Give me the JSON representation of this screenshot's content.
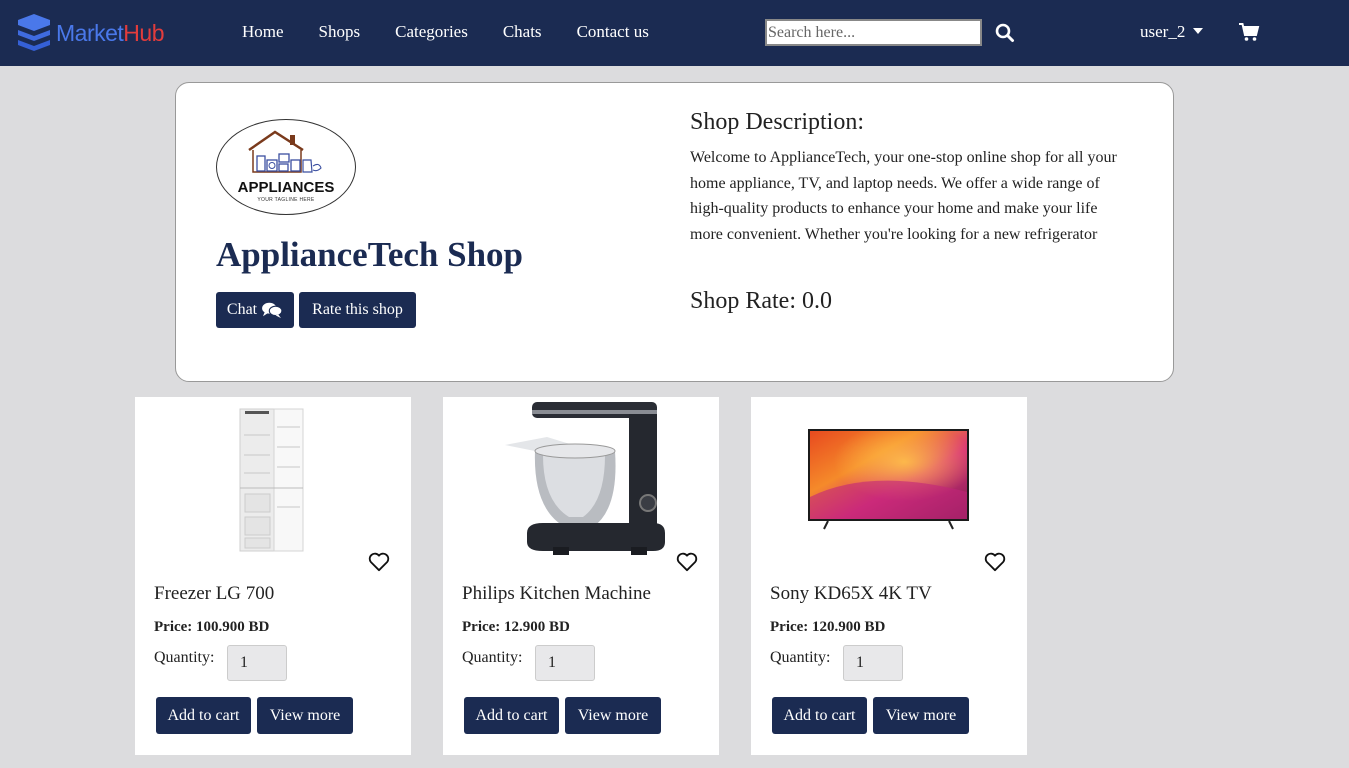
{
  "brand": {
    "part1": "Market",
    "part2": "Hub"
  },
  "nav": {
    "items": [
      "Home",
      "Shops",
      "Categories",
      "Chats",
      "Contact us"
    ]
  },
  "search": {
    "placeholder": "Search here...",
    "value": ""
  },
  "user": {
    "name": "user_2"
  },
  "shop": {
    "logo_text": "APPLIANCES",
    "logo_tagline": "YOUR TAGLINE HERE",
    "name": "ApplianceTech Shop",
    "chat_label": "Chat",
    "rate_label": "Rate this shop",
    "description_title": "Shop Description:",
    "description": "Welcome to ApplianceTech, your one-stop online shop for all your home appliance, TV, and laptop needs. We offer a wide range of high-quality products to enhance your home and make your life more convenient. Whether you're looking for a new refrigerator",
    "rate_label_text": "Shop Rate:",
    "rate_value": "0.0"
  },
  "products": [
    {
      "name": "Freezer LG 700",
      "price": "Price: 100.900 BD",
      "quantity_label": "Quantity:",
      "quantity": "1",
      "add_label": "Add to cart",
      "view_label": "View more",
      "image": "fridge"
    },
    {
      "name": "Philips Kitchen Machine",
      "price": "Price: 12.900 BD",
      "quantity_label": "Quantity:",
      "quantity": "1",
      "add_label": "Add to cart",
      "view_label": "View more",
      "image": "stand-mixer"
    },
    {
      "name": "Sony KD65X 4K TV",
      "price": "Price: 120.900 BD",
      "quantity_label": "Quantity:",
      "quantity": "1",
      "add_label": "Add to cart",
      "view_label": "View more",
      "image": "television"
    }
  ],
  "colors": {
    "navbar": "#1b2b52",
    "button": "#1b2b52",
    "background": "#dcdcde",
    "brand_blue": "#4a78ea",
    "brand_red": "#e23c3c"
  }
}
